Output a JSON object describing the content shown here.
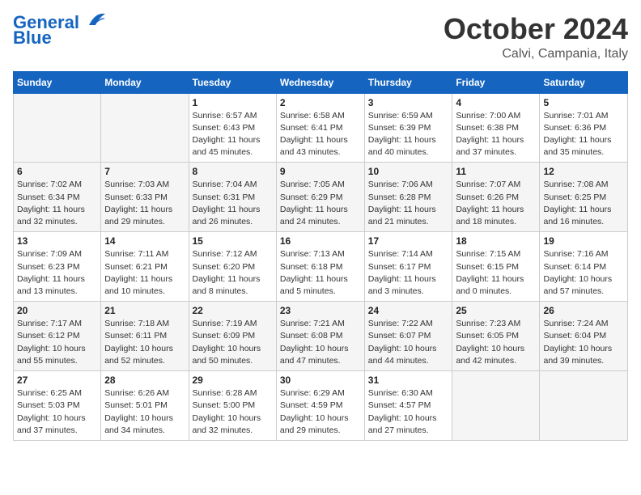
{
  "header": {
    "logo_line1": "General",
    "logo_line2": "Blue",
    "month": "October 2024",
    "location": "Calvi, Campania, Italy"
  },
  "days_of_week": [
    "Sunday",
    "Monday",
    "Tuesday",
    "Wednesday",
    "Thursday",
    "Friday",
    "Saturday"
  ],
  "weeks": [
    [
      {
        "day": "",
        "info": ""
      },
      {
        "day": "",
        "info": ""
      },
      {
        "day": "1",
        "info": "Sunrise: 6:57 AM\nSunset: 6:43 PM\nDaylight: 11 hours and 45 minutes."
      },
      {
        "day": "2",
        "info": "Sunrise: 6:58 AM\nSunset: 6:41 PM\nDaylight: 11 hours and 43 minutes."
      },
      {
        "day": "3",
        "info": "Sunrise: 6:59 AM\nSunset: 6:39 PM\nDaylight: 11 hours and 40 minutes."
      },
      {
        "day": "4",
        "info": "Sunrise: 7:00 AM\nSunset: 6:38 PM\nDaylight: 11 hours and 37 minutes."
      },
      {
        "day": "5",
        "info": "Sunrise: 7:01 AM\nSunset: 6:36 PM\nDaylight: 11 hours and 35 minutes."
      }
    ],
    [
      {
        "day": "6",
        "info": "Sunrise: 7:02 AM\nSunset: 6:34 PM\nDaylight: 11 hours and 32 minutes."
      },
      {
        "day": "7",
        "info": "Sunrise: 7:03 AM\nSunset: 6:33 PM\nDaylight: 11 hours and 29 minutes."
      },
      {
        "day": "8",
        "info": "Sunrise: 7:04 AM\nSunset: 6:31 PM\nDaylight: 11 hours and 26 minutes."
      },
      {
        "day": "9",
        "info": "Sunrise: 7:05 AM\nSunset: 6:29 PM\nDaylight: 11 hours and 24 minutes."
      },
      {
        "day": "10",
        "info": "Sunrise: 7:06 AM\nSunset: 6:28 PM\nDaylight: 11 hours and 21 minutes."
      },
      {
        "day": "11",
        "info": "Sunrise: 7:07 AM\nSunset: 6:26 PM\nDaylight: 11 hours and 18 minutes."
      },
      {
        "day": "12",
        "info": "Sunrise: 7:08 AM\nSunset: 6:25 PM\nDaylight: 11 hours and 16 minutes."
      }
    ],
    [
      {
        "day": "13",
        "info": "Sunrise: 7:09 AM\nSunset: 6:23 PM\nDaylight: 11 hours and 13 minutes."
      },
      {
        "day": "14",
        "info": "Sunrise: 7:11 AM\nSunset: 6:21 PM\nDaylight: 11 hours and 10 minutes."
      },
      {
        "day": "15",
        "info": "Sunrise: 7:12 AM\nSunset: 6:20 PM\nDaylight: 11 hours and 8 minutes."
      },
      {
        "day": "16",
        "info": "Sunrise: 7:13 AM\nSunset: 6:18 PM\nDaylight: 11 hours and 5 minutes."
      },
      {
        "day": "17",
        "info": "Sunrise: 7:14 AM\nSunset: 6:17 PM\nDaylight: 11 hours and 3 minutes."
      },
      {
        "day": "18",
        "info": "Sunrise: 7:15 AM\nSunset: 6:15 PM\nDaylight: 11 hours and 0 minutes."
      },
      {
        "day": "19",
        "info": "Sunrise: 7:16 AM\nSunset: 6:14 PM\nDaylight: 10 hours and 57 minutes."
      }
    ],
    [
      {
        "day": "20",
        "info": "Sunrise: 7:17 AM\nSunset: 6:12 PM\nDaylight: 10 hours and 55 minutes."
      },
      {
        "day": "21",
        "info": "Sunrise: 7:18 AM\nSunset: 6:11 PM\nDaylight: 10 hours and 52 minutes."
      },
      {
        "day": "22",
        "info": "Sunrise: 7:19 AM\nSunset: 6:09 PM\nDaylight: 10 hours and 50 minutes."
      },
      {
        "day": "23",
        "info": "Sunrise: 7:21 AM\nSunset: 6:08 PM\nDaylight: 10 hours and 47 minutes."
      },
      {
        "day": "24",
        "info": "Sunrise: 7:22 AM\nSunset: 6:07 PM\nDaylight: 10 hours and 44 minutes."
      },
      {
        "day": "25",
        "info": "Sunrise: 7:23 AM\nSunset: 6:05 PM\nDaylight: 10 hours and 42 minutes."
      },
      {
        "day": "26",
        "info": "Sunrise: 7:24 AM\nSunset: 6:04 PM\nDaylight: 10 hours and 39 minutes."
      }
    ],
    [
      {
        "day": "27",
        "info": "Sunrise: 6:25 AM\nSunset: 5:03 PM\nDaylight: 10 hours and 37 minutes."
      },
      {
        "day": "28",
        "info": "Sunrise: 6:26 AM\nSunset: 5:01 PM\nDaylight: 10 hours and 34 minutes."
      },
      {
        "day": "29",
        "info": "Sunrise: 6:28 AM\nSunset: 5:00 PM\nDaylight: 10 hours and 32 minutes."
      },
      {
        "day": "30",
        "info": "Sunrise: 6:29 AM\nSunset: 4:59 PM\nDaylight: 10 hours and 29 minutes."
      },
      {
        "day": "31",
        "info": "Sunrise: 6:30 AM\nSunset: 4:57 PM\nDaylight: 10 hours and 27 minutes."
      },
      {
        "day": "",
        "info": ""
      },
      {
        "day": "",
        "info": ""
      }
    ]
  ]
}
